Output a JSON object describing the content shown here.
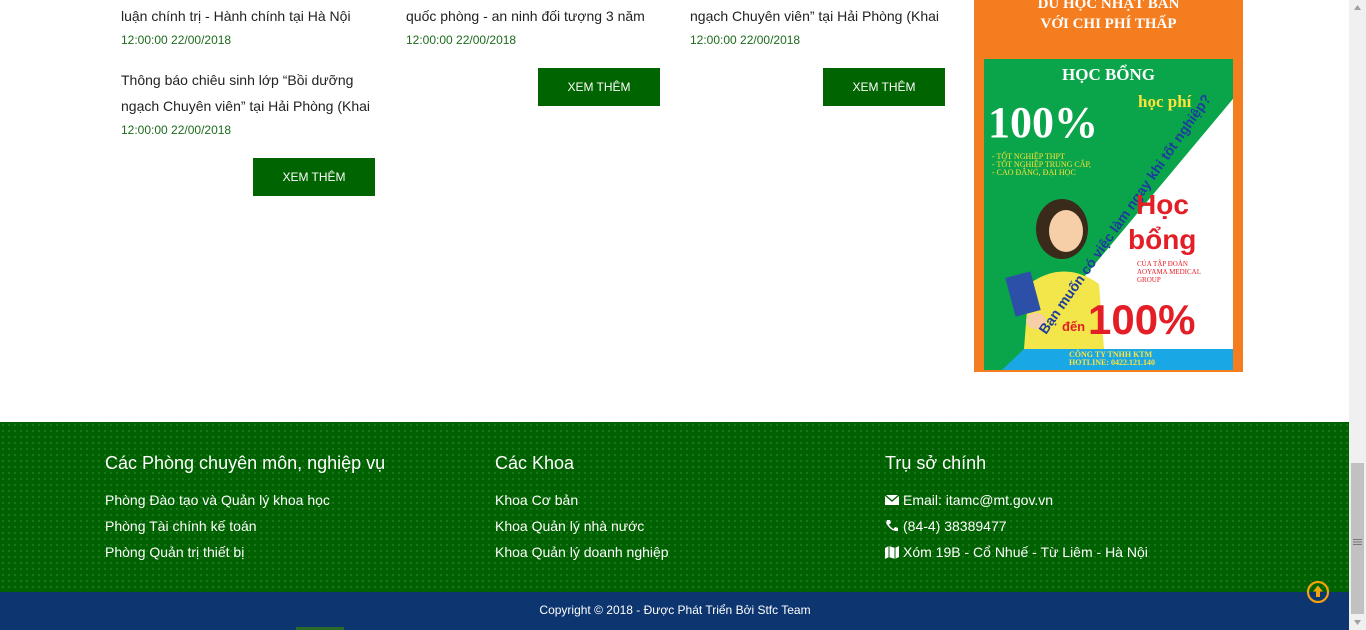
{
  "news": {
    "col1": {
      "items": [
        {
          "title": "luận chính trị - Hành chính tại Hà Nội",
          "time": "12:00:00 22/00/2018"
        },
        {
          "title_line1": "Thông báo chiêu sinh lớp “Bồi dưỡng",
          "title_line2": "ngạch Chuyên viên” tại Hải Phòng (Khai",
          "time": "12:00:00 22/00/2018"
        }
      ],
      "more_label": "XEM THÊM"
    },
    "col2": {
      "items": [
        {
          "title": "quốc phòng - an ninh đối tượng 3 năm",
          "time": "12:00:00 22/00/2018"
        }
      ],
      "more_label": "XEM THÊM"
    },
    "col3": {
      "items": [
        {
          "title": "ngạch Chuyên viên” tại Hải Phòng (Khai",
          "time": "12:00:00 22/00/2018"
        }
      ],
      "more_label": "XEM THÊM"
    }
  },
  "ad": {
    "head_line1": "DU HỌC NHẬT BẢN",
    "head_line2": "VỚI CHI PHÍ THẤP",
    "hoc_bong": "HỌC BỔNG",
    "percent": "100%",
    "hoc_phi": "học phí",
    "bullets": [
      "- TỐT NGHIỆP THPT",
      "- TỐT NGHIỆP TRUNG CẤP,",
      "- CAO ĐẲNG, ĐẠI HỌC"
    ],
    "diagonal": "Bạn muốn có việc làm ngay khi tốt nghiệp?",
    "hoc": "Học",
    "bong": "bổng",
    "group1": "CỦA TẬP ĐOÀN",
    "group2": "AOYAMA MEDICAL",
    "group3": "GROUP",
    "den": "đến",
    "percent2": "100%",
    "company": "CÔNG TY TNHH KTM",
    "hotline": "HOTLINE: 0422.121.140"
  },
  "footer": {
    "col1": {
      "heading": "Các Phòng chuyên môn, nghiệp vụ",
      "links": [
        "Phòng Đào tạo và Quản lý khoa học",
        "Phòng Tài chính kế toán",
        "Phòng Quản trị thiết bị"
      ]
    },
    "col2": {
      "heading": "Các Khoa",
      "links": [
        "Khoa Cơ bản",
        "Khoa Quản lý nhà nước",
        "Khoa Quản lý doanh nghiệp"
      ]
    },
    "col3": {
      "heading": "Trụ sở chính",
      "email": "Email: itamc@mt.gov.vn",
      "phone": "(84-4) 38389477",
      "address": "Xóm 19B - Cổ Nhuế - Từ Liêm - Hà Nội"
    },
    "copyright": "Copyright © 2018 - Được Phát Triển Bởi Stfc Team"
  },
  "colors": {
    "green": "#006400",
    "footer_green": "#006100",
    "navy": "#0d3670",
    "orange": "#f47d20",
    "date_green": "#1d6b1d"
  }
}
